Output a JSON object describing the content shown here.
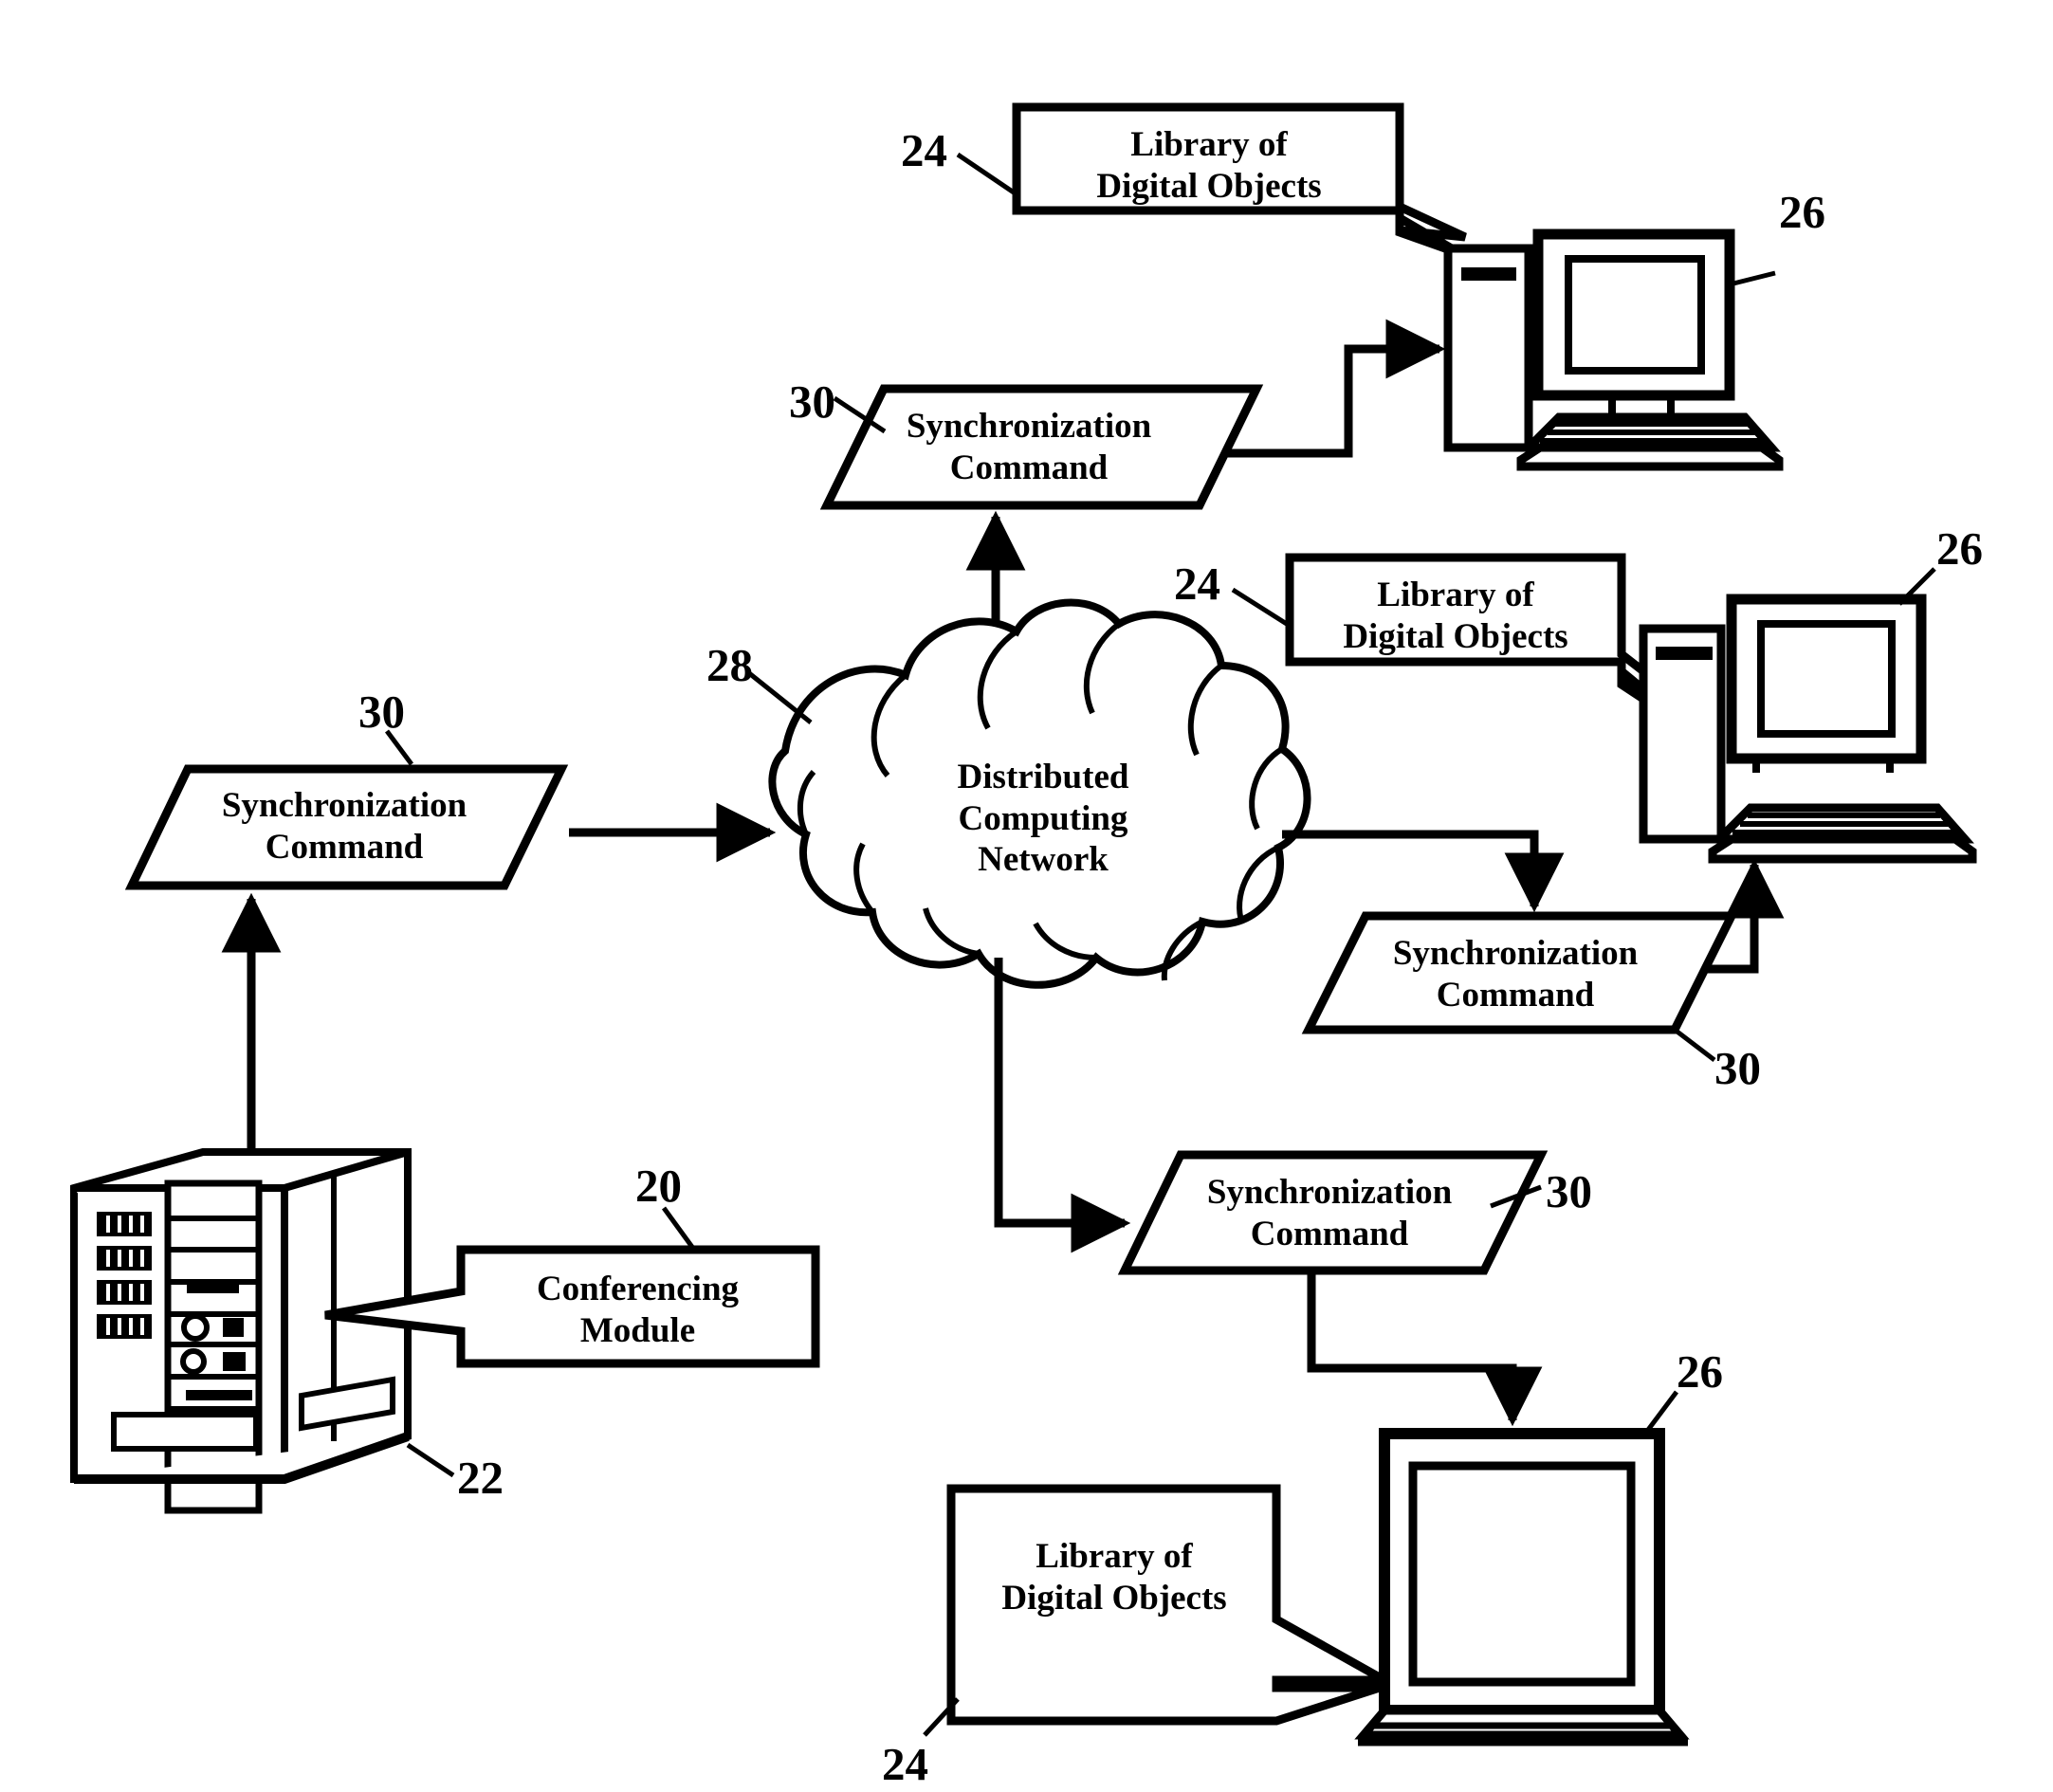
{
  "figure": {
    "type": "patent-system-diagram",
    "background": "#ffffff",
    "ink": "#000000"
  },
  "nodes": {
    "library_top": {
      "line1": "Library of",
      "line2": "Digital Objects",
      "ref": "24"
    },
    "library_mid": {
      "line1": "Library of",
      "line2": "Digital Objects",
      "ref": "24"
    },
    "library_bottom": {
      "line1": "Library of",
      "line2": "Digital Objects",
      "ref": "24"
    },
    "sync_top": {
      "line1": "Synchronization",
      "line2": "Command",
      "ref": "30"
    },
    "sync_left": {
      "line1": "Synchronization",
      "line2": "Command",
      "ref": "30"
    },
    "sync_right": {
      "line1": "Synchronization",
      "line2": "Command",
      "ref": "30"
    },
    "sync_bottom": {
      "line1": "Synchronization",
      "line2": "Command",
      "ref": "30"
    },
    "cloud": {
      "line1": "Distributed",
      "line2": "Computing",
      "line3": "Network",
      "ref": "28"
    },
    "conferencing_module": {
      "line1": "Conferencing",
      "line2": "Module",
      "ref": "20"
    },
    "server": {
      "ref": "22",
      "icon": "server-tower-icon"
    },
    "client_top": {
      "ref": "26",
      "icon": "desktop-computer-icon"
    },
    "client_mid": {
      "ref": "26",
      "icon": "desktop-computer-icon"
    },
    "client_bottom": {
      "ref": "26",
      "icon": "laptop-computer-icon"
    }
  },
  "reference_numerals": {
    "conferencing_module": "20",
    "server": "22",
    "library_of_digital_objects": "24",
    "client_computer": "26",
    "distributed_computing_network": "28",
    "synchronization_command": "30"
  }
}
